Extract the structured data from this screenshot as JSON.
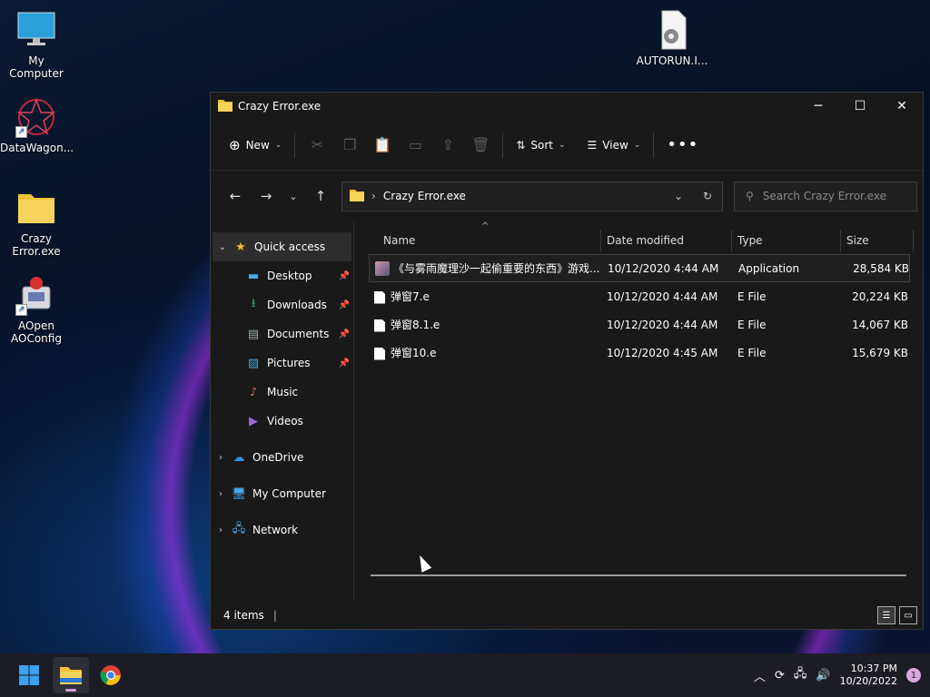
{
  "desktop": {
    "icons": [
      {
        "label": "My Computer"
      },
      {
        "label": "DataWagon..."
      },
      {
        "label": "Crazy Error.exe"
      },
      {
        "label": "AOpen AOConfig"
      },
      {
        "label": "AUTORUN.I..."
      }
    ]
  },
  "window": {
    "title": "Crazy Error.exe",
    "toolbar": {
      "new_label": "New",
      "sort_label": "Sort",
      "view_label": "View"
    },
    "address": {
      "path": "Crazy Error.exe"
    },
    "search": {
      "placeholder": "Search Crazy Error.exe"
    },
    "nav": {
      "quick_access": "Quick access",
      "items": [
        {
          "label": "Desktop"
        },
        {
          "label": "Downloads"
        },
        {
          "label": "Documents"
        },
        {
          "label": "Pictures"
        },
        {
          "label": "Music"
        },
        {
          "label": "Videos"
        }
      ],
      "onedrive": "OneDrive",
      "my_computer": "My Computer",
      "network": "Network"
    },
    "columns": {
      "name": "Name",
      "date": "Date modified",
      "type": "Type",
      "size": "Size"
    },
    "files": [
      {
        "name": "《与雾雨魔理沙一起偷重要的东西》游戏...",
        "date": "10/12/2020 4:44 AM",
        "type": "Application",
        "size": "28,584 KB"
      },
      {
        "name": "弹窗7.e",
        "date": "10/12/2020 4:44 AM",
        "type": "E File",
        "size": "20,224 KB"
      },
      {
        "name": "弹窗8.1.e",
        "date": "10/12/2020 4:44 AM",
        "type": "E File",
        "size": "14,067 KB"
      },
      {
        "name": "弹窗10.e",
        "date": "10/12/2020 4:45 AM",
        "type": "E File",
        "size": "15,679 KB"
      }
    ],
    "status": {
      "count": "4 items"
    }
  },
  "taskbar": {
    "time": "10:37 PM",
    "date": "10/20/2022",
    "notification_count": "1"
  }
}
